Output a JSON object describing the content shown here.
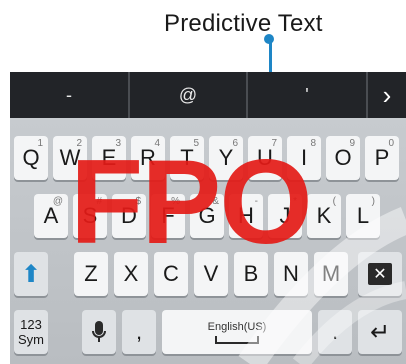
{
  "callout": {
    "label": "Predictive Text"
  },
  "prediction_bar": {
    "suggestions": [
      "-",
      "@",
      "'"
    ],
    "more_icon": "chevron-right-icon"
  },
  "rows": {
    "row1": [
      {
        "label": "Q",
        "sub": "1"
      },
      {
        "label": "W",
        "sub": "2"
      },
      {
        "label": "E",
        "sub": "3"
      },
      {
        "label": "R",
        "sub": "4"
      },
      {
        "label": "T",
        "sub": "5"
      },
      {
        "label": "Y",
        "sub": "6"
      },
      {
        "label": "U",
        "sub": "7"
      },
      {
        "label": "I",
        "sub": "8"
      },
      {
        "label": "O",
        "sub": "9"
      },
      {
        "label": "P",
        "sub": "0"
      }
    ],
    "row2": [
      {
        "label": "A",
        "sub": "@"
      },
      {
        "label": "S",
        "sub": "#"
      },
      {
        "label": "D",
        "sub": "$"
      },
      {
        "label": "F",
        "sub": "%"
      },
      {
        "label": "G",
        "sub": "&"
      },
      {
        "label": "H",
        "sub": "-"
      },
      {
        "label": "J",
        "sub": "*"
      },
      {
        "label": "K",
        "sub": "("
      },
      {
        "label": "L",
        "sub": ")"
      }
    ],
    "row3": [
      {
        "label": "Z",
        "sub": ""
      },
      {
        "label": "X",
        "sub": ""
      },
      {
        "label": "C",
        "sub": ""
      },
      {
        "label": "V",
        "sub": ""
      },
      {
        "label": "B",
        "sub": ""
      },
      {
        "label": "N",
        "sub": ""
      },
      {
        "label": "M",
        "sub": ""
      }
    ]
  },
  "bottom_row": {
    "symbols_label_top": "123",
    "symbols_label_bottom": "Sym",
    "comma": ",",
    "space_label": "English(US)",
    "period": "."
  },
  "overlay": {
    "text": "FPO",
    "color": "#e41b17"
  },
  "colors": {
    "accent": "#1e86c6",
    "bar": "#222428"
  }
}
